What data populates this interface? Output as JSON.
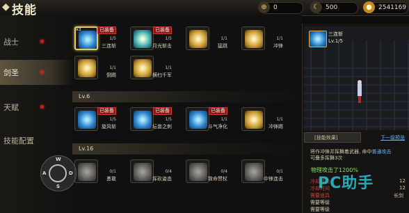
{
  "header": {
    "title": "技能",
    "resources": [
      {
        "icon": "target-icon",
        "value": "0"
      },
      {
        "icon": "moon-coin-icon",
        "value": "500"
      },
      {
        "icon": "gold-coin-icon",
        "value": "2541169"
      }
    ]
  },
  "sidebar": {
    "items": [
      {
        "label": "战士"
      },
      {
        "label": "剑圣"
      },
      {
        "label": "天赋"
      },
      {
        "label": "技能配置"
      }
    ]
  },
  "skills": {
    "row1": [
      {
        "name": "三连斩",
        "level": "1/5",
        "equipped": "已装备",
        "badge": "x3",
        "color": "blue",
        "selected": true
      },
      {
        "name": "月光斩击",
        "level": "1/5",
        "equipped": "已装备",
        "color": "green"
      },
      {
        "name": "猛跳",
        "level": "1/1",
        "color": "gold"
      },
      {
        "name": "冲锋",
        "level": "1/1",
        "color": "gold"
      }
    ],
    "row2": [
      {
        "name": "倒踢",
        "level": "1/1",
        "color": "gold"
      },
      {
        "name": "横扫千军",
        "level": "1/1",
        "color": "gold"
      }
    ],
    "lv6_label": "Lv.6",
    "row3": [
      {
        "name": "旋风斩",
        "level": "1/5",
        "equipped": "已装备",
        "color": "blue"
      },
      {
        "name": "坛兽之刺",
        "level": "1/5",
        "equipped": "已装备",
        "color": "blue"
      },
      {
        "name": "斗气净化",
        "level": "1/1",
        "equipped": "已装备",
        "color": "blue"
      },
      {
        "name": "冲锋踢",
        "level": "1/1",
        "color": "gold"
      }
    ],
    "lv16_label": "Lv.16",
    "row4": [
      {
        "name": "勇敢",
        "level": "0/1",
        "color": "grey"
      },
      {
        "name": "挥砍姿态",
        "level": "0/4",
        "color": "grey"
      },
      {
        "name": "致命赞杖",
        "level": "0/4",
        "color": "grey"
      },
      {
        "name": "中锋连击",
        "level": "0/1",
        "color": "grey"
      }
    ]
  },
  "detail": {
    "name": "三连斩",
    "level": "Lv.1/5",
    "effect_tab": "[技能效果]",
    "next_level_link": "下一级预览",
    "desc_line1_a": "将作冲锋并挥舞着武器, 命中",
    "desc_line1_b": "普通攻击",
    "desc_line2": "可叠多挥舞3次",
    "damage": "物理攻击了1200%",
    "stats": [
      {
        "label": "冷却时间",
        "value": "12"
      },
      {
        "label": "冷却时间",
        "value": "12"
      },
      {
        "label": "需要道具",
        "value": "长剑"
      },
      {
        "label": "需要等级",
        "value": ""
      },
      {
        "label": "需要等级",
        "value": ""
      }
    ]
  },
  "joystick": {
    "up": "W",
    "left": "A",
    "down": "S",
    "right": "D"
  },
  "watermark": "PC助手",
  "colors": {
    "accent": "#e8c867",
    "equipped_bg": "#8a1c17",
    "link": "#6ab3ff",
    "damage": "#8be05a"
  }
}
